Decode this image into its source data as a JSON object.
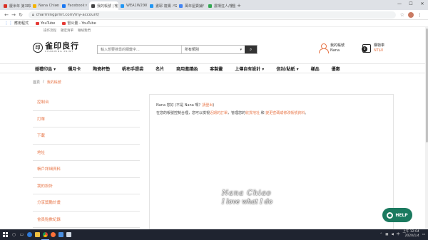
{
  "browser": {
    "tabs": [
      {
        "label": "慶米年 第32期",
        "color": "#d93025",
        "active": false
      },
      {
        "label": "Nana Chiao",
        "color": "#f4b400",
        "active": false
      },
      {
        "label": "Facebook",
        "color": "#1877f2",
        "active": false
      },
      {
        "label": "我的帳號 | 雀印良行",
        "color": "#444444",
        "active": true
      },
      {
        "label": "WEA1W2001",
        "color": "#2196f3",
        "active": false
      },
      {
        "label": "晝耶 複購 - Goo",
        "color": "#2196f3",
        "active": false
      },
      {
        "label": "萬年屋賣鋪",
        "color": "#4285f4",
        "active": false
      },
      {
        "label": "農場狂人/樓盤",
        "color": "#34a853",
        "active": false
      }
    ],
    "new_tab": "+",
    "url": "charmingprint.com/my-account/",
    "bookmarks": [
      {
        "label": "應用程式",
        "icon": "grid-icon"
      },
      {
        "label": "YouTube",
        "icon": "youtube-icon"
      },
      {
        "label": "雷公量 - YouTube",
        "icon": "youtube-icon"
      }
    ]
  },
  "site": {
    "top_links": [
      "操作流程",
      "顯定清單",
      "聯絡我們"
    ],
    "logo": {
      "text": "雀印良行",
      "sub": "CHARMING PRINT",
      "mark": "印"
    },
    "search": {
      "placeholder": "輸入想要搜尋的關鍵字...",
      "category": "所有類別",
      "button_icon": "search-icon"
    },
    "account": {
      "label": "我的帳號",
      "name": "Nana"
    },
    "cart": {
      "label": "購物車",
      "amount": "NT$0",
      "count": "0"
    },
    "nav": [
      "婚禮印品 ▾",
      "彌月卡",
      "陶瓷杯墊",
      "帆布手提袋",
      "名片",
      "商用邀請函",
      "客製畫",
      "上傳自有設計 ▾",
      "信封/貼紙 ▾",
      "樣品",
      "優惠"
    ]
  },
  "breadcrumb": {
    "home": "首頁",
    "sep": "/",
    "current": "我的帳號"
  },
  "account_menu": [
    "控制台",
    "訂單",
    "下載",
    "地址",
    "帳戶詳細資料",
    "我的設計",
    "分享獎勵計畫",
    "會員點數紀錄"
  ],
  "dashboard": {
    "greeting_prefix": "Nana 您好 (不是 Nana 嗎？",
    "logout": "請登出",
    "greeting_suffix": ")",
    "desc_1": "在您的帳號控制台裡，您可以檢視",
    "link_orders": "近期的訂單",
    "desc_2": "，管理您的",
    "link_address": "收貨地址",
    "desc_3": "和",
    "link_account": "變更密碼或修改帳號資料",
    "desc_4": "。"
  },
  "signature": {
    "line1": "Nana Chiao",
    "line2": "I love what I do"
  },
  "help_button": {
    "label": "HELP"
  },
  "taskbar": {
    "time": "上午 12:04",
    "date": "2020/1/4",
    "lang": "中"
  }
}
